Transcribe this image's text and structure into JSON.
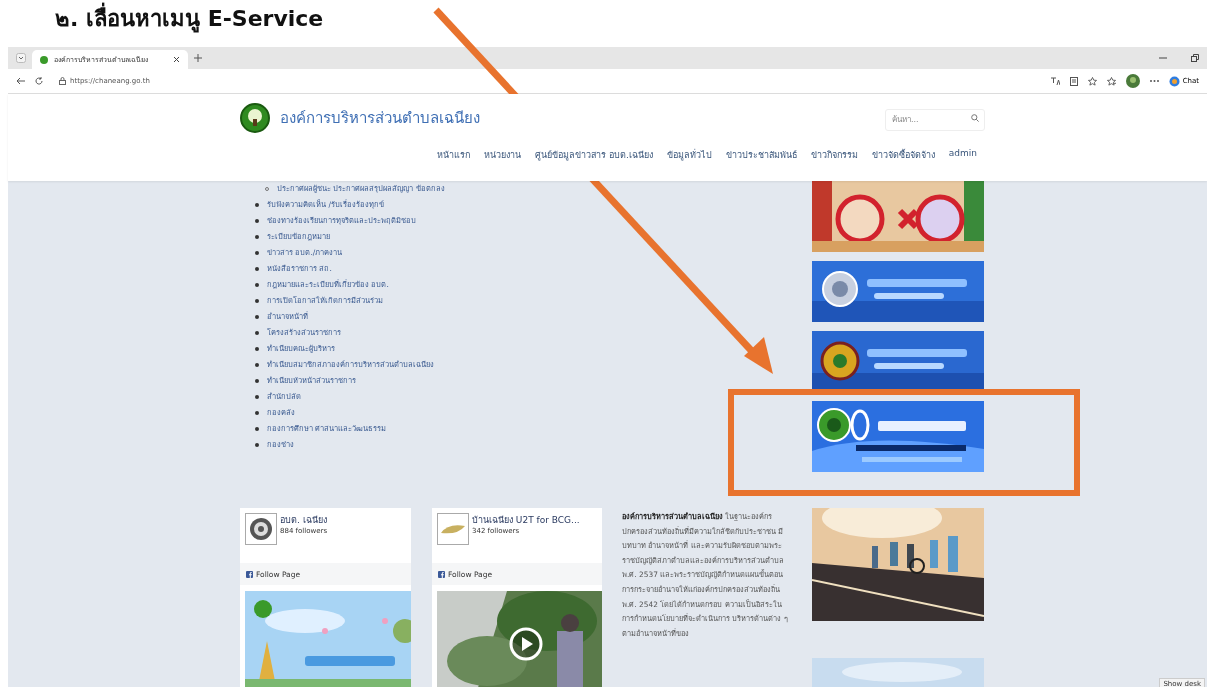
{
  "heading": "๒. เลื่อนหาเมนู E-Service",
  "browser": {
    "tabs": [
      {
        "title": "องค์การบริหารส่วนตำบลเฉนียง",
        "selected": true
      }
    ],
    "url": "https://chaneang.go.th",
    "chat_button": "Chat"
  },
  "site": {
    "title": "องค์การบริหารส่วนตำบลเฉนียง",
    "search": {
      "placeholder": "ค้นหา..."
    },
    "nav": [
      {
        "label": "หน้าแรก"
      },
      {
        "label": "หน่วยงาน"
      },
      {
        "label": "ศูนย์ข้อมูลข่าวสาร อบต.เฉนียง"
      },
      {
        "label": "ข้อมูลทั่วไป"
      },
      {
        "label": "ข่าวประชาสัมพันธ์"
      },
      {
        "label": "ข่าวกิจกรรม"
      },
      {
        "label": "ข่าวจัดซื้อจัดจ้าง"
      },
      {
        "label": "admin"
      }
    ]
  },
  "links": [
    {
      "children": [
        {
          "text": "ประกาศผลผู้ชนะ ประกาศผลสรุปผลสัญญา ข้อตกลง"
        }
      ]
    },
    {
      "text": "รับฟังความคิดเห็น /รับเรื่องร้องทุกข์"
    },
    {
      "text": "ช่องทางร้องเรียนการทุจริตและประพฤติมิชอบ"
    },
    {
      "text": "ระเบียบข้อกฎหมาย"
    },
    {
      "text": "ข่าวสาร อบต./ภาคงาน"
    },
    {
      "text": "หนังสือราชการ สถ."
    },
    {
      "text": "กฎหมายและระเบียบที่เกี่ยวข้อง อบต."
    },
    {
      "text": "การเปิดโอกาสให้เกิดการมีส่วนร่วม"
    },
    {
      "text": "อำนาจหน้าที่"
    },
    {
      "text": "โครงสร้างส่วนราชการ"
    },
    {
      "text": "ทำเนียบคณะผู้บริหาร"
    },
    {
      "text": "ทำเนียบสมาชิกสภาองค์การบริหารส่วนตำบลเฉนียง"
    },
    {
      "text": "ทำเนียบหัวหน้าส่วนราชการ"
    },
    {
      "text": "สำนักปลัด"
    },
    {
      "text": "กองคลัง"
    },
    {
      "text": "กองการศึกษา ศาสนาและวัฒนธรรม"
    },
    {
      "text": "กองช่าง"
    }
  ],
  "feeds": [
    {
      "name": "อบต. เฉนียง",
      "followers": "884 followers",
      "button": "Follow Page"
    },
    {
      "name": "บ้านเฉนียง U2T for BCG...",
      "followers": "342 followers",
      "button": "Follow Page",
      "media": {
        "kind": "video"
      }
    }
  ],
  "about": "**องค์การบริหารส่วนตำบลเฉนียง** ในฐานะองค์กรปกครองส่วนท้องถิ่นที่มีความใกล้ชิดกับประชาชน มีบทบาท อำนาจหน้าที่ และความรับผิดชอบตามพระราชบัญญัติสภาตำบลและองค์การบริหารส่วนตำบล พ.ศ. 2537 และพระราชบัญญัติกำหนดแผนขั้นตอนการกระจายอำนาจให้แก่องค์กรปกครองส่วนท้องถิ่น พ.ศ. 2542 โดยได้กำหนดกรอบ ความเป็นอิสระในการกำหนดนโยบายที่จะดำเนินการ บริหารด้านต่าง ๆ ตามอำนาจหน้าที่ของ",
  "show_desktop": "Show desk"
}
